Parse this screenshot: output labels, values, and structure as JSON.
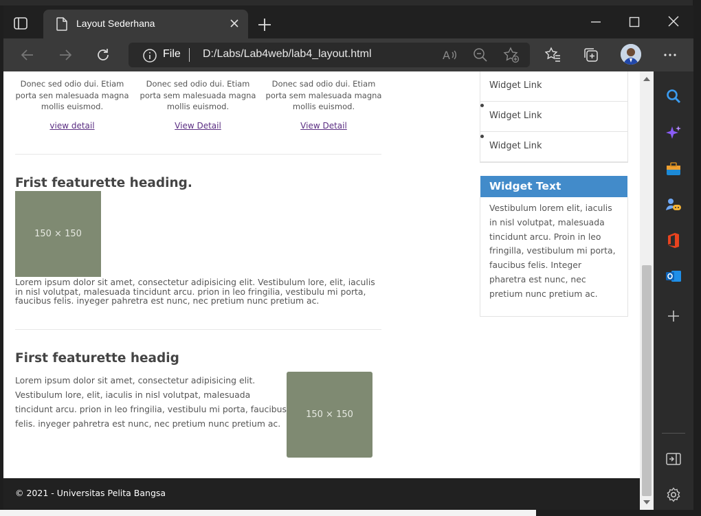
{
  "browser": {
    "tab_title": "Layout Sederhana",
    "address_scheme": "File",
    "address_url": "D:/Labs/Lab4web/lab4_layout.html"
  },
  "colors": {
    "accent_header": "#428bca",
    "placeholder_bg": "#7f8a72",
    "footer_bg": "#212121",
    "link": "#5a2d82"
  },
  "columns": [
    {
      "text": "Donec sed odio dui. Etiam porta sen malesuada magna mollis euismod.",
      "link": "view detail"
    },
    {
      "text": "Donec sed odio dui. Etiam porta sem malesuada magna mollis euismod.",
      "link": "View Detail"
    },
    {
      "text": "Donec sad odio dui. Etiam porta sem malesuada magna mollis euismod.",
      "link": "View Detail"
    }
  ],
  "featurettes": [
    {
      "heading": "Frist featurette heading.",
      "image_label": "150 × 150",
      "text": "Lorem ipsum dolor sit amet, consectetur adipisicing elit. Vestibulum lore, elit, iaculis in nisl volutpat, malesuada tincidunt arcu. prion in leo fringilia, vestibulu mi porta, faucibus felis. inyeger pahretra est nunc, nec pretium nunc pretium ac."
    },
    {
      "heading": "First featurette headig",
      "image_label": "150 × 150",
      "text": "Lorem ipsum dolor sit amet, consectetur adipisicing elit. Vestibulum lore, elit, iaculis in nisl volutpat, malesuada tincidunt arcu. prion in leo fringilia, vestibulu mi porta, faucibus felis. inyeger pahretra est nunc, nec pretium nunc pretium ac."
    }
  ],
  "widgets": {
    "links": [
      "Widget Link",
      "Widget Link",
      "Widget Link"
    ],
    "text_title": "Widget Text",
    "text_body": "Vestibulum lorem elit, iaculis in nisl volutpat, malesuada tincidunt arcu. Proin in leo fringilla, vestibulum mi porta, faucibus felis. Integer pharetra est nunc, nec pretium nunc pretium ac."
  },
  "footer": {
    "text": "© 2021 - Universitas Pelita Bangsa"
  },
  "icons": {
    "tab_actions": "tab-actions-icon",
    "page": "page-icon",
    "close_tab": "close-icon",
    "new_tab": "plus-icon",
    "back": "back-arrow-icon",
    "forward": "forward-arrow-icon",
    "refresh": "refresh-icon",
    "info": "info-icon",
    "read_aloud": "read-aloud-icon",
    "zoom_out": "zoom-out-icon",
    "add_favorite": "add-favorite-icon",
    "favorites": "favorites-icon",
    "collections": "collections-icon",
    "more": "more-icon",
    "sidebar": [
      "search-icon",
      "sparkle-icon",
      "briefcase-icon",
      "games-icon",
      "office-icon",
      "outlook-icon",
      "add-icon",
      "hide-sidebar-icon",
      "settings-icon"
    ]
  }
}
